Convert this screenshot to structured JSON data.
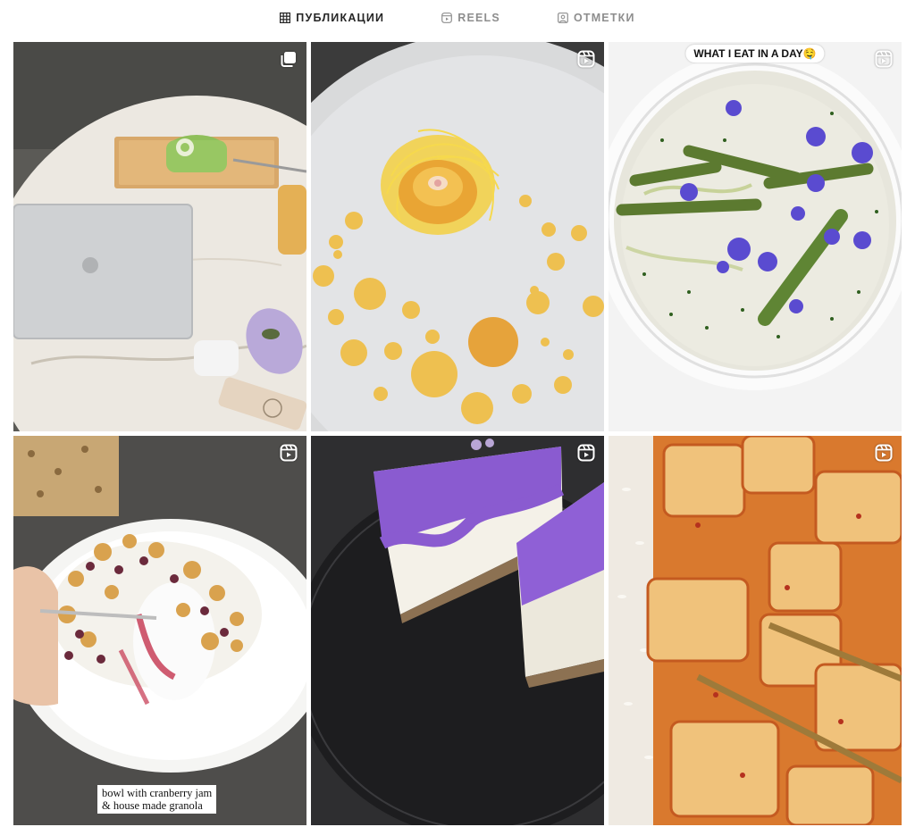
{
  "tabs": [
    {
      "label": "ПУБЛИКАЦИИ",
      "icon": "grid-icon",
      "active": true
    },
    {
      "label": "REELS",
      "icon": "reels-icon",
      "active": false
    },
    {
      "label": "ОТМЕТКИ",
      "icon": "tagged-icon",
      "active": false
    }
  ],
  "posts": [
    {
      "type": "carousel",
      "icon": "carousel-icon"
    },
    {
      "type": "reel",
      "icon": "reels-icon"
    },
    {
      "type": "reel",
      "icon": "reels-icon",
      "caption": "WHAT I EAT IN A DAY🤤"
    },
    {
      "type": "reel",
      "icon": "reels-icon",
      "caption_lines": [
        "bowl with cranberry jam",
        "& house made granola"
      ]
    },
    {
      "type": "reel",
      "icon": "reels-icon"
    },
    {
      "type": "reel",
      "icon": "reels-icon"
    }
  ]
}
